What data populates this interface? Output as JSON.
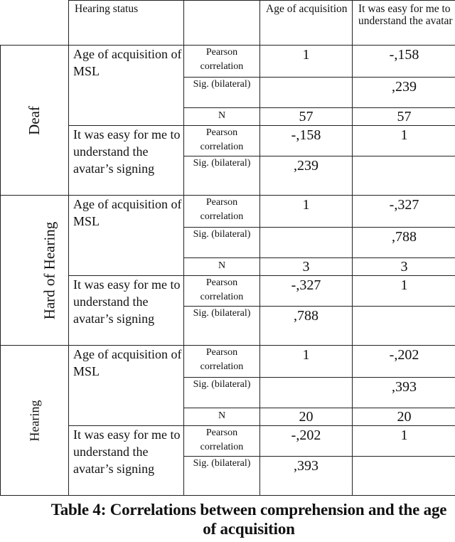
{
  "table": {
    "headers": {
      "hearing_status": "Hearing status",
      "stat_blank": "",
      "col_age": "Age of acquisition",
      "col_easy": "It was easy for me to understand the avatar"
    },
    "row_labels": {
      "age": "Age of acquisition of MSL",
      "easy": "It was easy for me to understand the avatar’s signing"
    },
    "stat_labels": {
      "pearson": "Pearson correlation",
      "sig": "Sig. (bilateral)",
      "n": "N"
    },
    "groups": [
      {
        "name": "Deaf",
        "age_row": {
          "pearson": [
            "1",
            "-,158"
          ],
          "sig": [
            "",
            ",239"
          ],
          "n": [
            "57",
            "57"
          ]
        },
        "easy_row": {
          "pearson": [
            "-,158",
            "1"
          ],
          "sig": [
            ",239",
            ""
          ]
        }
      },
      {
        "name": "Hard of Hearing",
        "age_row": {
          "pearson": [
            "1",
            "-,327"
          ],
          "sig": [
            "",
            ",788"
          ],
          "n": [
            "3",
            "3"
          ]
        },
        "easy_row": {
          "pearson": [
            "-,327",
            "1"
          ],
          "sig": [
            ",788",
            ""
          ]
        }
      },
      {
        "name": "Hearing",
        "age_row": {
          "pearson": [
            "1",
            "-,202"
          ],
          "sig": [
            "",
            ",393"
          ],
          "n": [
            "20",
            "20"
          ]
        },
        "easy_row": {
          "pearson": [
            "-,202",
            "1"
          ],
          "sig": [
            ",393",
            ""
          ]
        }
      }
    ]
  },
  "caption": "Table 4: Correlations between comprehension and the age of acquisition"
}
